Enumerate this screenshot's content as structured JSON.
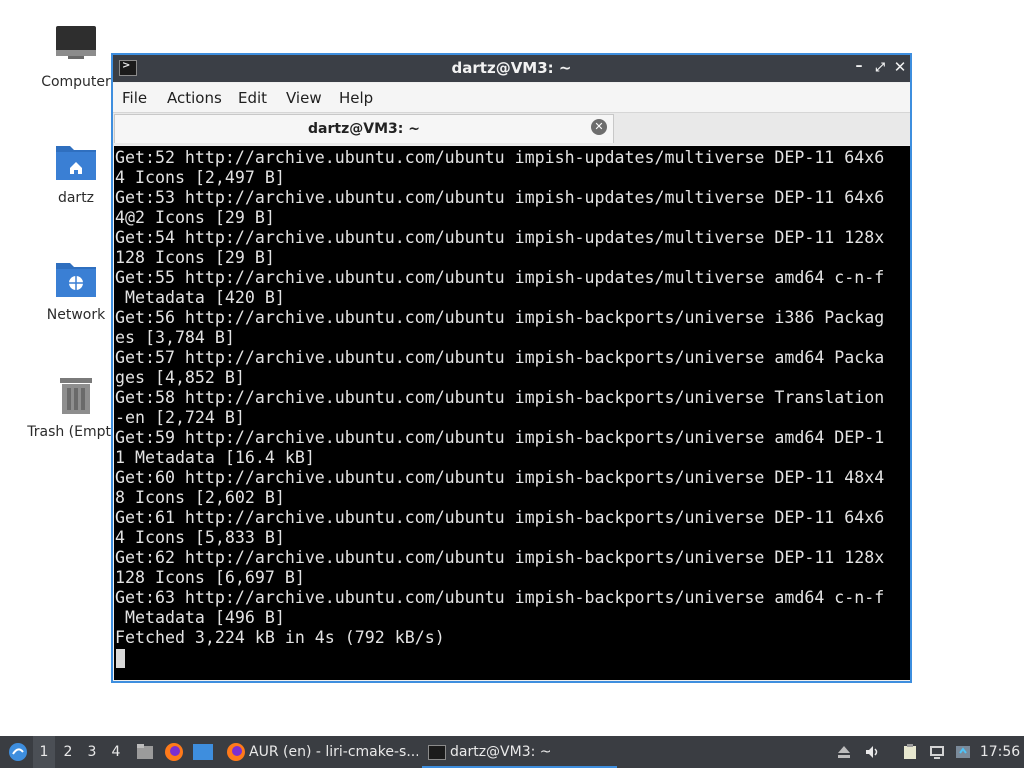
{
  "desktop": {
    "icons": [
      {
        "label": "Computer"
      },
      {
        "label": "dartz"
      },
      {
        "label": "Network"
      },
      {
        "label": "Trash (Empty)"
      }
    ]
  },
  "window": {
    "title": "dartz@VM3: ~",
    "menu": [
      "File",
      "Actions",
      "Edit",
      "View",
      "Help"
    ],
    "tab_title": "dartz@VM3: ~",
    "lines": [
      "Get:52 http://archive.ubuntu.com/ubuntu impish-updates/multiverse DEP-11 64x6",
      "4 Icons [2,497 B]",
      "Get:53 http://archive.ubuntu.com/ubuntu impish-updates/multiverse DEP-11 64x6",
      "4@2 Icons [29 B]",
      "Get:54 http://archive.ubuntu.com/ubuntu impish-updates/multiverse DEP-11 128x",
      "128 Icons [29 B]",
      "Get:55 http://archive.ubuntu.com/ubuntu impish-updates/multiverse amd64 c-n-f",
      " Metadata [420 B]",
      "Get:56 http://archive.ubuntu.com/ubuntu impish-backports/universe i386 Packag",
      "es [3,784 B]",
      "Get:57 http://archive.ubuntu.com/ubuntu impish-backports/universe amd64 Packa",
      "ges [4,852 B]",
      "Get:58 http://archive.ubuntu.com/ubuntu impish-backports/universe Translation",
      "-en [2,724 B]",
      "Get:59 http://archive.ubuntu.com/ubuntu impish-backports/universe amd64 DEP-1",
      "1 Metadata [16.4 kB]",
      "Get:60 http://archive.ubuntu.com/ubuntu impish-backports/universe DEP-11 48x4",
      "8 Icons [2,602 B]",
      "Get:61 http://archive.ubuntu.com/ubuntu impish-backports/universe DEP-11 64x6",
      "4 Icons [5,833 B]",
      "Get:62 http://archive.ubuntu.com/ubuntu impish-backports/universe DEP-11 128x",
      "128 Icons [6,697 B]",
      "Get:63 http://archive.ubuntu.com/ubuntu impish-backports/universe amd64 c-n-f",
      " Metadata [496 B]",
      "Fetched 3,224 kB in 4s (792 kB/s)"
    ]
  },
  "taskbar": {
    "workspaces": [
      "1",
      "2",
      "3",
      "4"
    ],
    "tasks": [
      {
        "label": "AUR (en) - liri-cmake-s...",
        "icon": "firefox-icon"
      },
      {
        "label": "dartz@VM3: ~",
        "icon": "terminal-icon"
      }
    ],
    "clock": "17:56"
  },
  "colors": {
    "accent": "#3e8ede",
    "titlebar": "#3b3f46",
    "terminal_bg": "#000000",
    "terminal_fg": "#e3e3e3",
    "folder": "#3a7fd4",
    "taskbar": "#3a3d42"
  }
}
